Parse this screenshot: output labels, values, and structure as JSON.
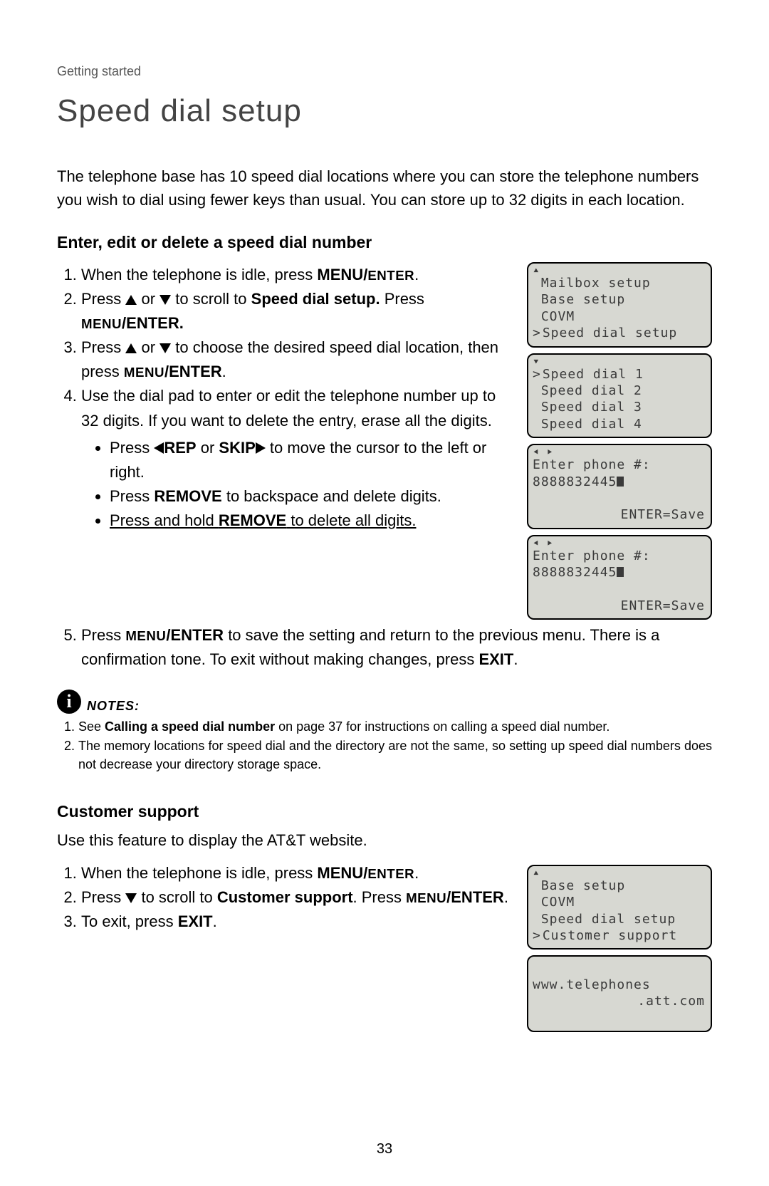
{
  "breadcrumb": "Getting started",
  "title": "Speed dial setup",
  "intro": "The telephone base has 10 speed dial locations where you can store the telephone numbers you wish to dial using fewer keys than usual. You can store up to 32 digits in each location.",
  "section1_title": "Enter, edit or delete a speed dial number",
  "steps1": {
    "s1_a": "When the telephone is idle, press ",
    "s1_b": "MENU/",
    "s1_c": "ENTER",
    "s1_d": ".",
    "s2_a": "Press ",
    "s2_b": " or ",
    "s2_c": " to scroll to ",
    "s2_d": "Speed dial setup.",
    "s2_e": " Press ",
    "s2_f": "MENU",
    "s2_g": "/ENTER.",
    "s3_a": "Press ",
    "s3_b": " or ",
    "s3_c": " to choose the desired speed dial location, then press ",
    "s3_d": "MENU",
    "s3_e": "/ENTER",
    "s3_f": ".",
    "s4": "Use the dial pad to enter or edit the telephone number up to 32 digits. If you want to delete the entry, erase all the digits.",
    "s4b1_a": "Press ",
    "s4b1_b": "REP",
    "s4b1_c": " or ",
    "s4b1_d": "SKIP",
    "s4b1_e": " to move the cursor to the left or right.",
    "s4b2_a": "Press ",
    "s4b2_b": "REMOVE",
    "s4b2_c": " to backspace and delete digits.",
    "s4b3_a": "Press and hold ",
    "s4b3_b": "REMOVE",
    "s4b3_c": " to delete all digits.",
    "s5_a": "Press ",
    "s5_b": "MENU",
    "s5_c": "/ENTER",
    "s5_d": " to save the setting and return to the previous menu. There is a confirmation tone. To exit without making changes, press ",
    "s5_e": "EXIT",
    "s5_f": "."
  },
  "notes_label": "NOTES:",
  "notes": {
    "n1_a": "See ",
    "n1_b": "Calling a speed dial number",
    "n1_c": " on page 37 for instructions on calling a speed dial number.",
    "n2": "The memory locations for speed dial and the directory are not the same, so setting up speed dial numbers does not decrease your directory storage space."
  },
  "section2_title": "Customer support",
  "section2_intro": "Use this feature to display the AT&T website.",
  "steps2": {
    "s1_a": "When the telephone is idle, press ",
    "s1_b": "MENU/",
    "s1_c": "ENTER",
    "s1_d": ".",
    "s2_a": "Press ",
    "s2_b": " to scroll to ",
    "s2_c": "Customer support",
    "s2_d": ". Press ",
    "s2_e": "MENU",
    "s2_f": "/ENTER",
    "s2_g": ".",
    "s3_a": "To exit, press ",
    "s3_b": "EXIT",
    "s3_c": "."
  },
  "lcd": {
    "menu1": {
      "l1": " Mailbox setup",
      "l2": " Base setup",
      "l3": " COVM",
      "l4": "Speed dial setup"
    },
    "menu2": {
      "l1": "Speed dial 1",
      "l2": " Speed dial 2",
      "l3": " Speed dial 3",
      "l4": " Speed dial 4"
    },
    "enter1": {
      "l1": "Enter phone #:",
      "num": "8888832445",
      "save": "ENTER=Save"
    },
    "enter2": {
      "l1": "Enter phone #:",
      "num": "8888832445",
      "save": "ENTER=Save"
    },
    "menu3": {
      "l1": " Base setup",
      "l2": " COVM",
      "l3": " Speed dial setup",
      "l4": "Customer support"
    },
    "url": {
      "l1": "www.telephones",
      "l2": ".att.com"
    }
  },
  "page_number": "33"
}
